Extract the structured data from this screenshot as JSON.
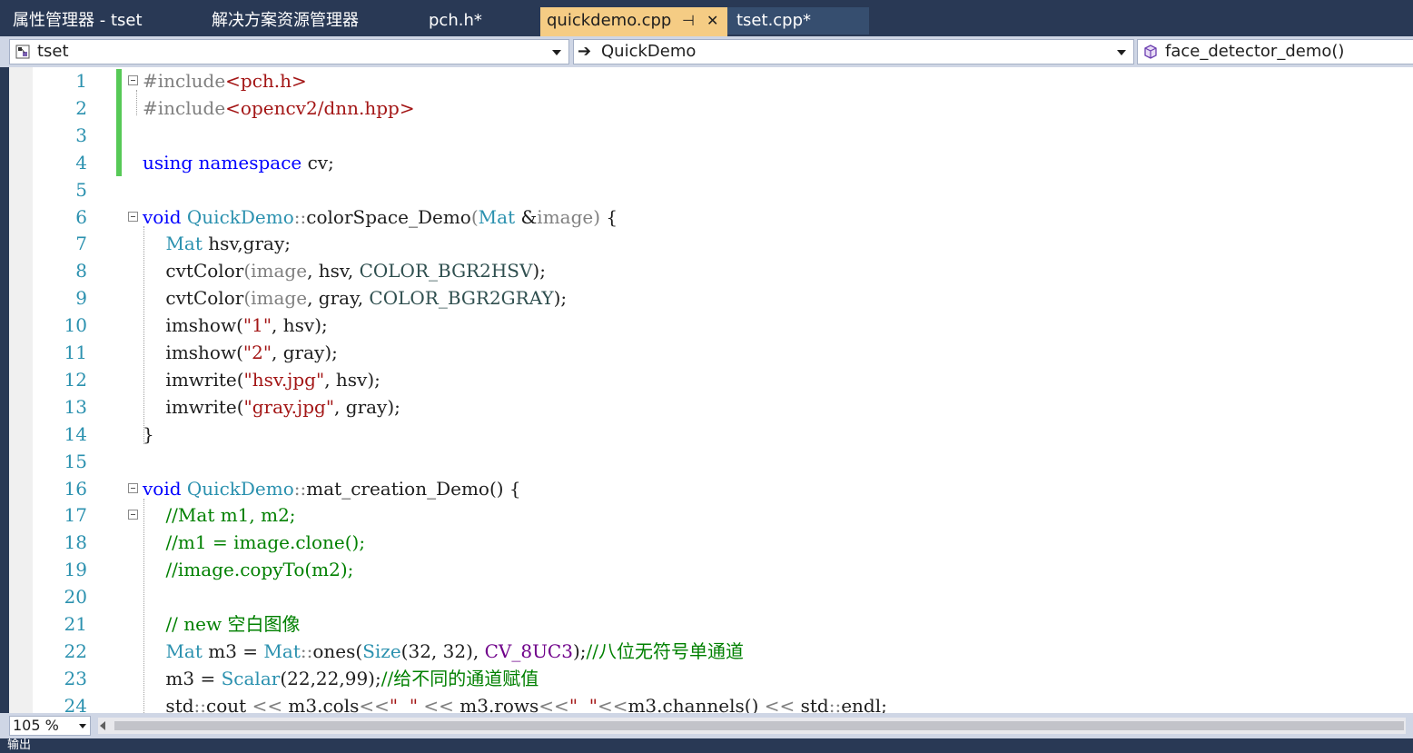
{
  "tabs": [
    {
      "label": "属性管理器 - tset"
    },
    {
      "label": "解决方案资源管理器"
    },
    {
      "label": "pch.h*"
    },
    {
      "label": "quickdemo.cpp",
      "pin": "⊣",
      "close": "✕"
    },
    {
      "label": "tset.cpp*"
    }
  ],
  "nav": {
    "project": "tset",
    "scope": "QuickDemo",
    "member": "face_detector_demo()"
  },
  "lines": [
    {
      "n": "1",
      "parts": [
        [
          "pp",
          "#include"
        ],
        [
          "str",
          "<pch.h>"
        ]
      ]
    },
    {
      "n": "2",
      "parts": [
        [
          "pp",
          "#include"
        ],
        [
          "str",
          "<opencv2/dnn.hpp>"
        ]
      ]
    },
    {
      "n": "3",
      "parts": []
    },
    {
      "n": "4",
      "parts": [
        [
          "kw",
          "using"
        ],
        [
          "p",
          " "
        ],
        [
          "kw",
          "namespace"
        ],
        [
          "p",
          " cv;"
        ]
      ]
    },
    {
      "n": "5",
      "parts": []
    },
    {
      "n": "6",
      "parts": [
        [
          "kw",
          "void"
        ],
        [
          "p",
          " "
        ],
        [
          "ty",
          "QuickDemo"
        ],
        [
          "par",
          "::"
        ],
        [
          "p",
          "colorSpace_Demo"
        ],
        [
          "par",
          "("
        ],
        [
          "ty",
          "Mat"
        ],
        [
          "p",
          " &"
        ],
        [
          "par",
          "image"
        ],
        [
          "par",
          ")"
        ],
        [
          "p",
          " {"
        ]
      ]
    },
    {
      "n": "7",
      "parts": [
        [
          "p",
          "    "
        ],
        [
          "ty",
          "Mat"
        ],
        [
          "p",
          " hsv,gray;"
        ]
      ]
    },
    {
      "n": "8",
      "parts": [
        [
          "p",
          "    cvtColor"
        ],
        [
          "par",
          "("
        ],
        [
          "par",
          "image"
        ],
        [
          "p",
          ", hsv, "
        ],
        [
          "en",
          "COLOR_BGR2HSV"
        ],
        [
          "p",
          ");"
        ]
      ]
    },
    {
      "n": "9",
      "parts": [
        [
          "p",
          "    cvtColor"
        ],
        [
          "par",
          "("
        ],
        [
          "par",
          "image"
        ],
        [
          "p",
          ", gray, "
        ],
        [
          "en",
          "COLOR_BGR2GRAY"
        ],
        [
          "p",
          ");"
        ]
      ]
    },
    {
      "n": "10",
      "parts": [
        [
          "p",
          "    imshow("
        ],
        [
          "str",
          "\"1\""
        ],
        [
          "p",
          ", hsv);"
        ]
      ]
    },
    {
      "n": "11",
      "parts": [
        [
          "p",
          "    imshow("
        ],
        [
          "str",
          "\"2\""
        ],
        [
          "p",
          ", gray);"
        ]
      ]
    },
    {
      "n": "12",
      "parts": [
        [
          "p",
          "    imwrite("
        ],
        [
          "str",
          "\"hsv.jpg\""
        ],
        [
          "p",
          ", hsv);"
        ]
      ]
    },
    {
      "n": "13",
      "parts": [
        [
          "p",
          "    imwrite("
        ],
        [
          "str",
          "\"gray.jpg\""
        ],
        [
          "p",
          ", gray);"
        ]
      ]
    },
    {
      "n": "14",
      "parts": [
        [
          "p",
          "}"
        ]
      ]
    },
    {
      "n": "15",
      "parts": []
    },
    {
      "n": "16",
      "parts": [
        [
          "kw",
          "void"
        ],
        [
          "p",
          " "
        ],
        [
          "ty",
          "QuickDemo"
        ],
        [
          "par",
          "::"
        ],
        [
          "p",
          "mat_creation_Demo() {"
        ]
      ]
    },
    {
      "n": "17",
      "parts": [
        [
          "p",
          "    "
        ],
        [
          "cm",
          "//Mat m1, m2;"
        ]
      ]
    },
    {
      "n": "18",
      "parts": [
        [
          "p",
          "    "
        ],
        [
          "cm",
          "//m1 = image.clone();"
        ]
      ]
    },
    {
      "n": "19",
      "parts": [
        [
          "p",
          "    "
        ],
        [
          "cm",
          "//image.copyTo(m2);"
        ]
      ]
    },
    {
      "n": "20",
      "parts": []
    },
    {
      "n": "21",
      "parts": [
        [
          "p",
          "    "
        ],
        [
          "cm",
          "// new 空白图像"
        ]
      ]
    },
    {
      "n": "22",
      "parts": [
        [
          "p",
          "    "
        ],
        [
          "ty",
          "Mat"
        ],
        [
          "p",
          " m3 = "
        ],
        [
          "ty",
          "Mat"
        ],
        [
          "par",
          "::"
        ],
        [
          "p",
          "ones("
        ],
        [
          "ty",
          "Size"
        ],
        [
          "p",
          "(32, 32), "
        ],
        [
          "mac",
          "CV_8UC3"
        ],
        [
          "p",
          ");"
        ],
        [
          "cm",
          "//八位无符号单通道"
        ]
      ]
    },
    {
      "n": "23",
      "parts": [
        [
          "p",
          "    m3 = "
        ],
        [
          "ty",
          "Scalar"
        ],
        [
          "p",
          "(22,22,99);"
        ],
        [
          "cm",
          "//给不同的通道赋值"
        ]
      ]
    },
    {
      "n": "24",
      "parts": [
        [
          "p",
          "    std"
        ],
        [
          "par",
          "::"
        ],
        [
          "p",
          "cout "
        ],
        [
          "par",
          "<<"
        ],
        [
          "p",
          " m3.cols"
        ],
        [
          "par",
          "<<"
        ],
        [
          "str",
          "\"  \""
        ],
        [
          "p",
          " "
        ],
        [
          "par",
          "<<"
        ],
        [
          "p",
          " m3.rows"
        ],
        [
          "par",
          "<<"
        ],
        [
          "str",
          "\"  \""
        ],
        [
          "par",
          "<<"
        ],
        [
          "p",
          "m3.channels() "
        ],
        [
          "par",
          "<<"
        ],
        [
          "p",
          " std"
        ],
        [
          "par",
          "::"
        ],
        [
          "p",
          "endl;"
        ]
      ]
    }
  ],
  "zoom": {
    "value": "105 %"
  },
  "status": {
    "text": "输出"
  },
  "colors": {
    "accent": "#f5cc84",
    "chrome": "#293955",
    "toolbar": "#cfd6e5",
    "change_bar": "#57c957"
  }
}
